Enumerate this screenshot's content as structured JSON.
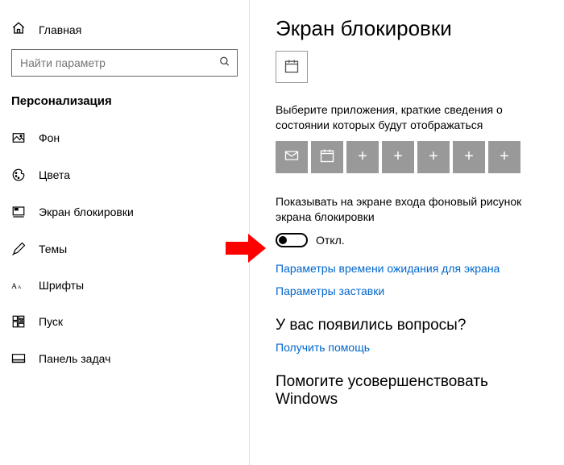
{
  "sidebar": {
    "home": "Главная",
    "search_placeholder": "Найти параметр",
    "section": "Персонализация",
    "items": [
      {
        "label": "Фон"
      },
      {
        "label": "Цвета"
      },
      {
        "label": "Экран блокировки"
      },
      {
        "label": "Темы"
      },
      {
        "label": "Шрифты"
      },
      {
        "label": "Пуск"
      },
      {
        "label": "Панель задач"
      }
    ]
  },
  "content": {
    "title": "Экран блокировки",
    "quick_desc": "Выберите приложения, краткие сведения о состоянии которых будут отображаться",
    "show_bg_desc": "Показывать на экране входа фоновый рисунок экрана блокировки",
    "toggle_label": "Откл.",
    "link_timeout": "Параметры времени ожидания для экрана",
    "link_screensaver": "Параметры заставки",
    "help_head": "У вас появились вопросы?",
    "help_link": "Получить помощь",
    "feedback_head": "Помогите усовершенствовать Windows"
  }
}
